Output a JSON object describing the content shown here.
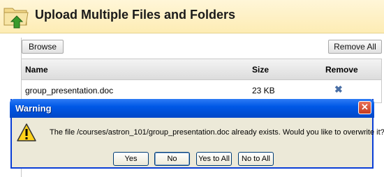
{
  "header": {
    "title": "Upload Multiple Files and Folders",
    "icon": "upload-folder-icon"
  },
  "toolbar": {
    "browse_label": "Browse",
    "remove_all_label": "Remove All"
  },
  "table": {
    "columns": [
      "Name",
      "Size",
      "Remove"
    ],
    "rows": [
      {
        "name": "group_presentation.doc",
        "size": "23 KB",
        "remove_icon": "remove-x-icon"
      }
    ]
  },
  "dialog": {
    "title": "Warning",
    "close_icon": "close-x-icon",
    "warning_icon": "warning-triangle-icon",
    "message": "The file /courses/astron_101/group_presentation.doc already exists.  Would you like to overwrite it?",
    "buttons": {
      "yes": "Yes",
      "no": "No",
      "yes_to_all": "Yes to All",
      "no_to_all": "No to All"
    }
  },
  "colors": {
    "header_bg": "#fdecb4",
    "titlebar": "#0058e6",
    "dialog_bg": "#ece9d8"
  }
}
